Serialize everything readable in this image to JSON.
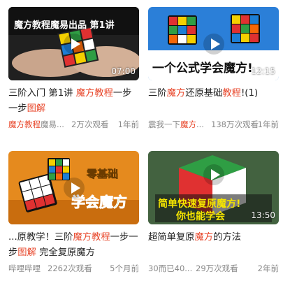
{
  "videos": [
    {
      "duration": "07:00",
      "thumb_text": [
        "魔方教程魔易出品 第1讲"
      ],
      "title": [
        {
          "t": "三阶入门 第1讲 ",
          "hl": false
        },
        {
          "t": "魔方教程",
          "hl": true
        },
        {
          "t": "一步一步",
          "hl": false
        },
        {
          "t": "图解",
          "hl": true
        }
      ],
      "source": [
        {
          "t": "魔方教程",
          "hl": true
        },
        {
          "t": "魔易...",
          "hl": false
        }
      ],
      "views": "2万次观看",
      "time": "1年前"
    },
    {
      "duration": "12:15",
      "thumb_text": [
        "一个公式学会魔方!"
      ],
      "title": [
        {
          "t": "三阶",
          "hl": false
        },
        {
          "t": "魔方",
          "hl": true
        },
        {
          "t": "还原基础",
          "hl": false
        },
        {
          "t": "教程",
          "hl": true
        },
        {
          "t": "!(1)",
          "hl": false
        }
      ],
      "source": [
        {
          "t": "震我一下",
          "hl": false
        },
        {
          "t": "魔方",
          "hl": true
        },
        {
          "t": "...",
          "hl": false
        }
      ],
      "views": "138万次观看",
      "time": "1年前"
    },
    {
      "duration": "",
      "thumb_text": [
        "零基础",
        "学会魔方"
      ],
      "title": [
        {
          "t": "...原教学！三阶",
          "hl": false
        },
        {
          "t": "魔方教程",
          "hl": true
        },
        {
          "t": "一步一步",
          "hl": false
        },
        {
          "t": "图解",
          "hl": true
        },
        {
          "t": " 完全复原魔方",
          "hl": false
        }
      ],
      "source": [
        {
          "t": "哔哩哔哩",
          "hl": false
        }
      ],
      "views": "2262次观看",
      "time": "5个月前"
    },
    {
      "duration": "13:50",
      "thumb_text": [
        "简单快速复原魔方!",
        "你也能学会"
      ],
      "title": [
        {
          "t": "超简单复原",
          "hl": false
        },
        {
          "t": "魔方",
          "hl": true
        },
        {
          "t": "的方法",
          "hl": false
        }
      ],
      "source": [
        {
          "t": "30而已40...",
          "hl": false
        }
      ],
      "views": "29万次观看",
      "time": "2年前"
    }
  ],
  "colors": {
    "highlight": "#e8472b",
    "meta": "#8a8a8a"
  }
}
